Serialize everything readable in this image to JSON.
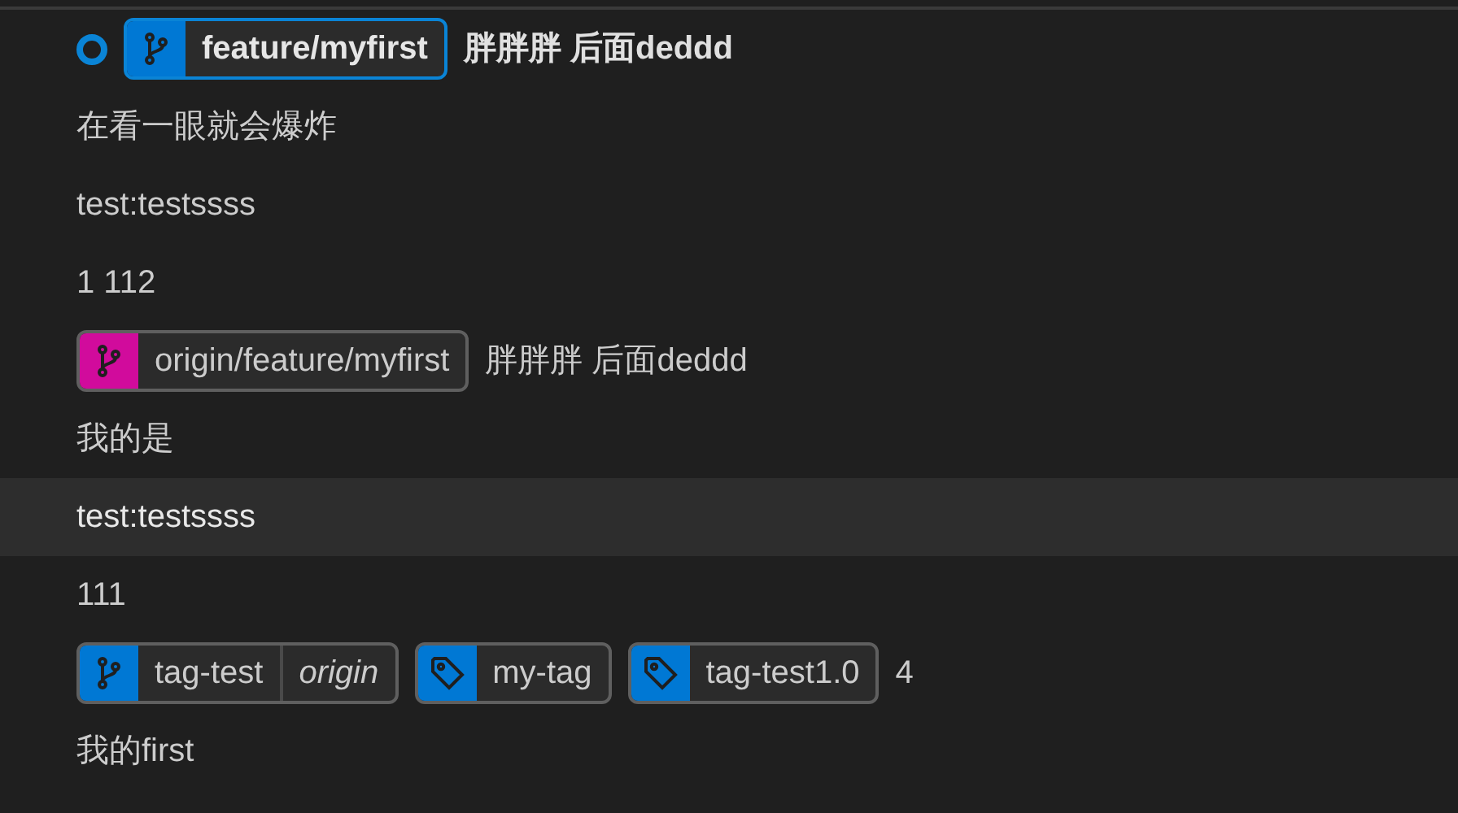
{
  "commits": [
    {
      "message": "胖胖胖 后面deddd",
      "current": true,
      "selected": false,
      "refs": [
        {
          "kind": "branch",
          "label": "feature/myfirst",
          "color": "#0078d4",
          "current": true
        }
      ]
    },
    {
      "message": "在看一眼就会爆炸",
      "current": false,
      "selected": false
    },
    {
      "message": "test:testssss",
      "current": false,
      "selected": false
    },
    {
      "message": "1 112",
      "current": false,
      "selected": false
    },
    {
      "message": "胖胖胖 后面deddd",
      "current": false,
      "selected": false,
      "refs": [
        {
          "kind": "branch",
          "label": "origin/feature/myfirst",
          "color": "#d10b9c",
          "current": false
        }
      ]
    },
    {
      "message": "我的是",
      "current": false,
      "selected": false
    },
    {
      "message": "test:testssss",
      "current": false,
      "selected": true
    },
    {
      "message": "111",
      "current": false,
      "selected": false
    },
    {
      "message": "4",
      "current": false,
      "selected": false,
      "refs": [
        {
          "kind": "branch",
          "label": "tag-test",
          "remote": "origin",
          "color": "#0078d4",
          "current": false
        },
        {
          "kind": "tag",
          "label": "my-tag",
          "color": "#0078d4",
          "current": false
        },
        {
          "kind": "tag",
          "label": "tag-test1.0",
          "color": "#0078d4",
          "current": false
        }
      ]
    },
    {
      "message": "我的first",
      "current": false,
      "selected": false
    }
  ]
}
